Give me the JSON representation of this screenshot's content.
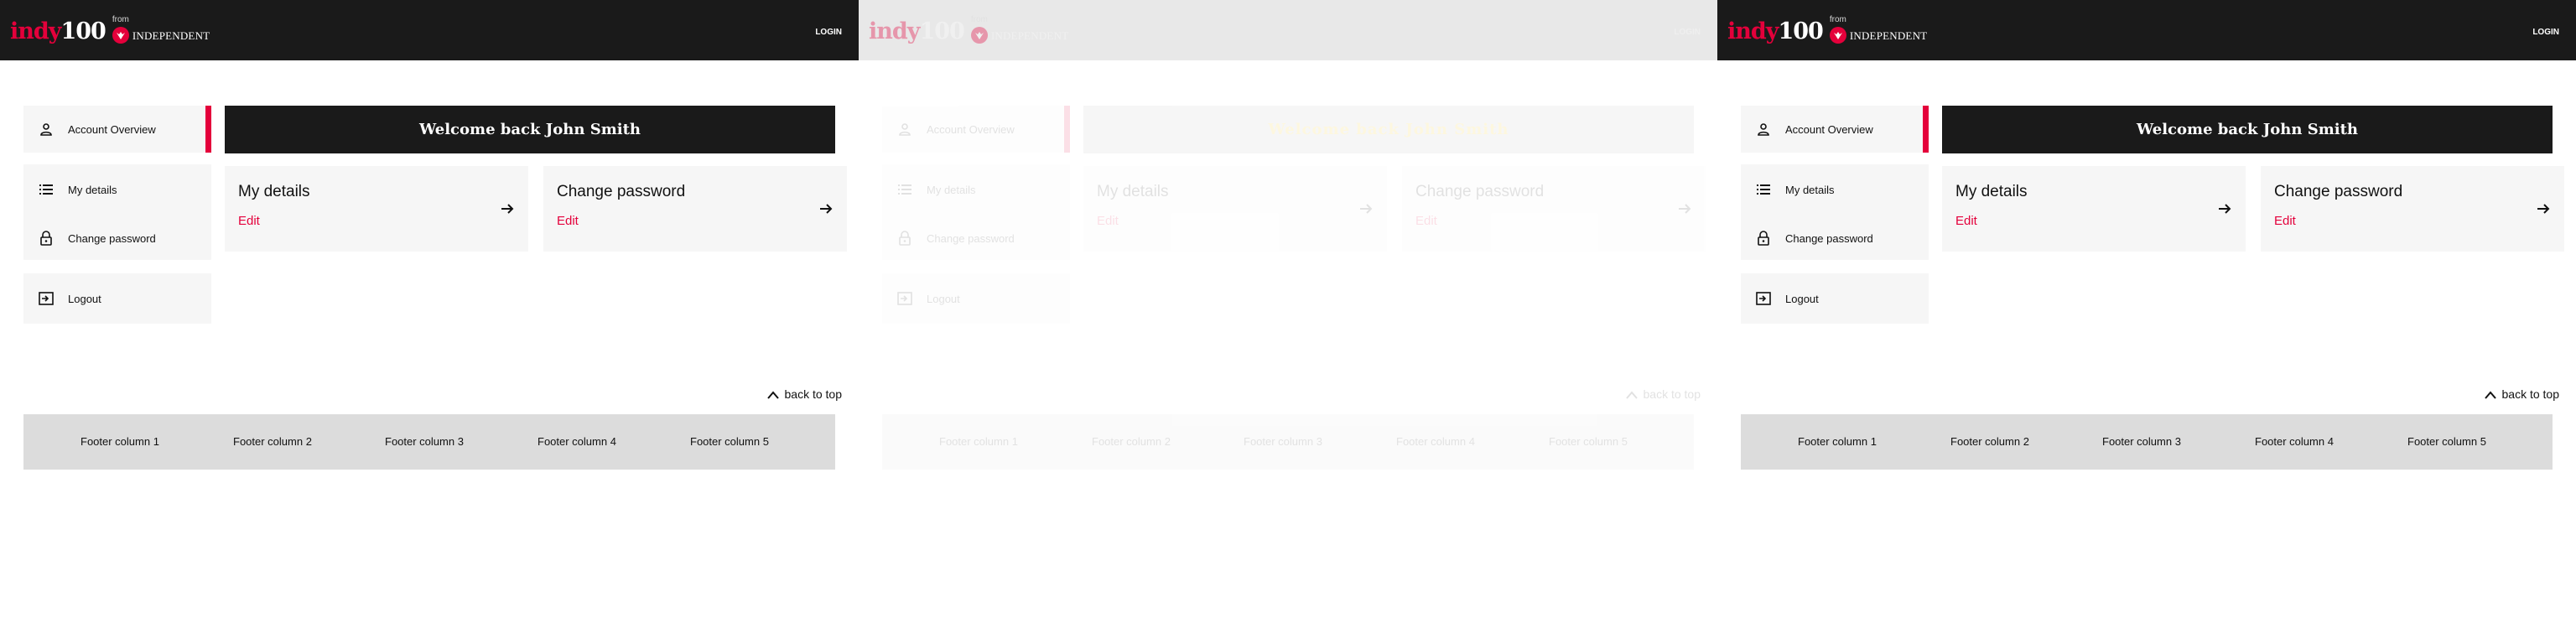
{
  "header": {
    "logo_indy": "indy",
    "logo_100": "100",
    "from_text": "from",
    "independent_text": "INDEPENDENT",
    "login_label": "LOGIN"
  },
  "sidebar": {
    "items": [
      {
        "label": "Account Overview",
        "icon": "user-icon"
      },
      {
        "label": "My details",
        "icon": "list-icon"
      },
      {
        "label": "Change password",
        "icon": "lock-icon"
      },
      {
        "label": "Logout",
        "icon": "logout-icon"
      }
    ]
  },
  "main": {
    "welcome": "Welcome back John Smith",
    "cards": [
      {
        "title": "My details",
        "edit": "Edit",
        "icon": "arrow-right-icon"
      },
      {
        "title": "Change password",
        "edit": "Edit",
        "icon": "arrow-right-icon"
      }
    ]
  },
  "back_to_top": "back to top",
  "footer": {
    "columns": [
      "Footer column 1",
      "Footer column 2",
      "Footer column 3",
      "Footer column 4",
      "Footer column 5"
    ]
  },
  "colors": {
    "accent": "#e4003b",
    "header_bg": "#1a1a1a",
    "card_bg": "#f6f6f6",
    "footer_bg": "#dcdcdc"
  }
}
